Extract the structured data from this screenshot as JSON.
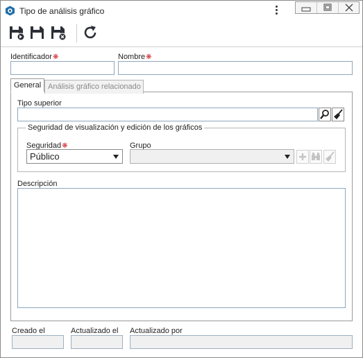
{
  "window": {
    "title": "Tipo de análisis gráfico"
  },
  "toolbar": {
    "buttons": [
      {
        "name": "save-new-icon"
      },
      {
        "name": "save-icon"
      },
      {
        "name": "save-close-icon"
      },
      {
        "name": "refresh-icon"
      }
    ]
  },
  "header_fields": {
    "identificador_label": "Identificador",
    "identificador_value": "",
    "nombre_label": "Nombre",
    "nombre_value": "",
    "required_mark": "❋"
  },
  "tabs": [
    {
      "label": "General",
      "active": true
    },
    {
      "label": "Análisis gráfico relacionado",
      "active": false
    }
  ],
  "general": {
    "tipo_superior_label": "Tipo superior",
    "tipo_superior_value": "",
    "security_group_legend": "Seguridad de visualización y edición de los gráficos",
    "seguridad_label": "Seguridad",
    "seguridad_value": "Público",
    "grupo_label": "Grupo",
    "grupo_value": "",
    "descripcion_label": "Descripción",
    "descripcion_value": ""
  },
  "footer": {
    "creado_label": "Creado el",
    "actualizado_label": "Actualizado el",
    "actualizado_por_label": "Actualizado por"
  },
  "colors": {
    "required": "#d0202a",
    "app_icon": "#1f6fa8",
    "disabled_text": "#8a8a8a"
  }
}
